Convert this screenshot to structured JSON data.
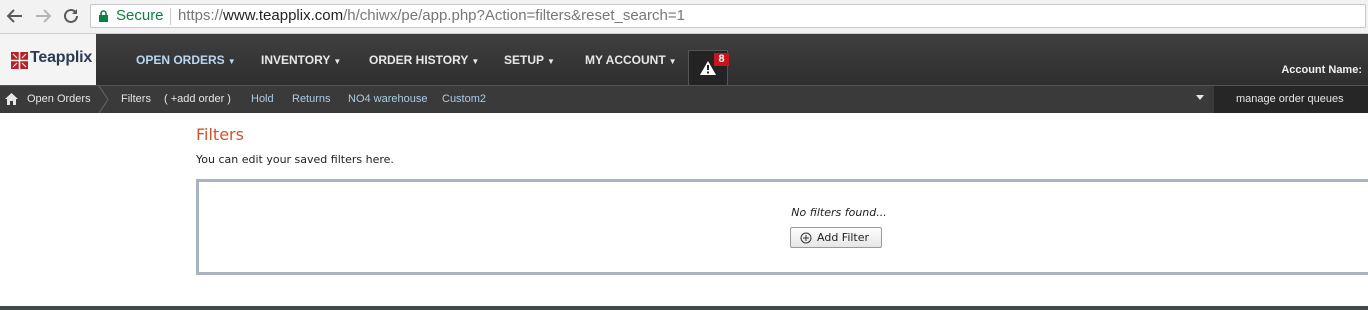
{
  "browser": {
    "secure_label": "Secure",
    "url_scheme": "https://",
    "url_domain": "www.teapplix.com",
    "url_path": "/h/chiwx/pe/app.php?Action=filters&reset_search=1"
  },
  "header": {
    "logo_text": "Teapplix",
    "menu": [
      {
        "label": "OPEN ORDERS"
      },
      {
        "label": "INVENTORY"
      },
      {
        "label": "ORDER HISTORY"
      },
      {
        "label": "SETUP"
      },
      {
        "label": "MY ACCOUNT"
      }
    ],
    "alert_count": "8",
    "account_label": "Account Name:"
  },
  "subnav": {
    "home_label": "Open Orders",
    "items": [
      {
        "label": "Filters"
      },
      {
        "label": "( +add order )"
      },
      {
        "label": "Hold"
      },
      {
        "label": "Returns"
      },
      {
        "label": "NO4 warehouse"
      },
      {
        "label": "Custom2"
      }
    ],
    "queues_label": "manage order queues"
  },
  "content": {
    "title": "Filters",
    "description": "You can edit your saved filters here.",
    "empty_message": "No filters found...",
    "add_filter_label": "Add Filter"
  },
  "colors": {
    "title_accent": "#d2542b",
    "secure_green": "#0b8043",
    "badge_red": "#c9141b",
    "header_dark": "#333333"
  }
}
